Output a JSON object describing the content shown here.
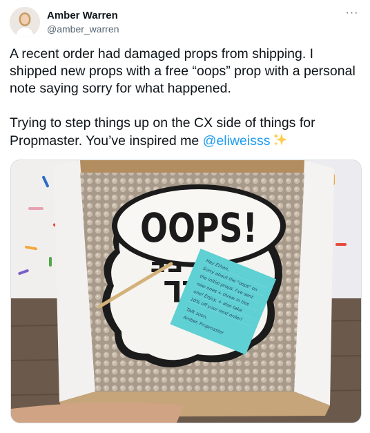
{
  "tweet": {
    "author_name": "Amber Warren",
    "author_handle": "@amber_warren",
    "more_label": "···",
    "paragraph1": "A recent order had damaged props from shipping. I shipped new props with a free “oops” prop with a personal note saying sorry for what happened.",
    "paragraph2_before": "Trying to step things up on the CX side of things for Propmaster. You’ve inspired me ",
    "mention": "@eliweisss",
    "sparkle_icon": "sparkles-emoji"
  },
  "photo": {
    "sign_text": "OOPS!",
    "back_sign_text_1": "TILL",
    "back_sign_text_2": "FE",
    "note_lines": [
      "Hey Ethan,",
      "Sorry about the \"oops\" on",
      "the initial props. I've sent",
      "new ones + threw in this",
      "one! Enjoy, + also take",
      "10% off your next order!",
      "Talk soon,",
      "Amber, Propmaster"
    ]
  },
  "colors": {
    "accent": "#1d9bf0",
    "text": "#0f1419",
    "secondary": "#536471",
    "note": "#5fd0d3"
  }
}
